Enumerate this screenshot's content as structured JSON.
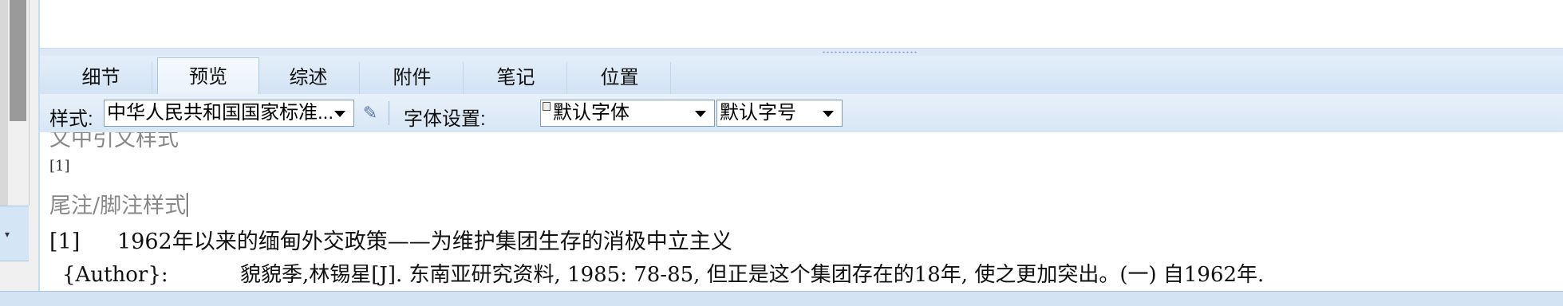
{
  "colors": {
    "panel_bg": "#d7e6f5",
    "tab_active_bg": "#eaf2fb",
    "muted_text": "#888888"
  },
  "left_panel": {
    "collapse_icon": "triangle-down-icon",
    "collapse_glyph": "▾"
  },
  "tabs": [
    {
      "label": "细节",
      "active": false
    },
    {
      "label": "预览",
      "active": true
    },
    {
      "label": "综述",
      "active": false
    },
    {
      "label": "附件",
      "active": false
    },
    {
      "label": "笔记",
      "active": false
    },
    {
      "label": "位置",
      "active": false
    }
  ],
  "toolbar": {
    "style_label": "样式:",
    "style_value": "中华人民共和国国家标准...",
    "edit_icon": "edit-style-icon",
    "edit_glyph": "✎",
    "font_settings_label": "字体设置:",
    "font_value": "默认字体",
    "font_size_value": "默认字号"
  },
  "preview": {
    "partial_heading": "文中引文样式",
    "citation_mark": "[1]",
    "endnote_heading": "尾注/脚注样式",
    "entry": {
      "number": "[1]",
      "title": "1962年以来的缅甸外交政策——为维护集团生存的消极中立主义",
      "field_name": "{Author}:",
      "field_value": "貌貌季,林锡星[J]. 东南亚研究资料, 1985: 78-85, 但正是这个集团存在的18年, 使之更加突出。(一) 自1962年."
    }
  }
}
